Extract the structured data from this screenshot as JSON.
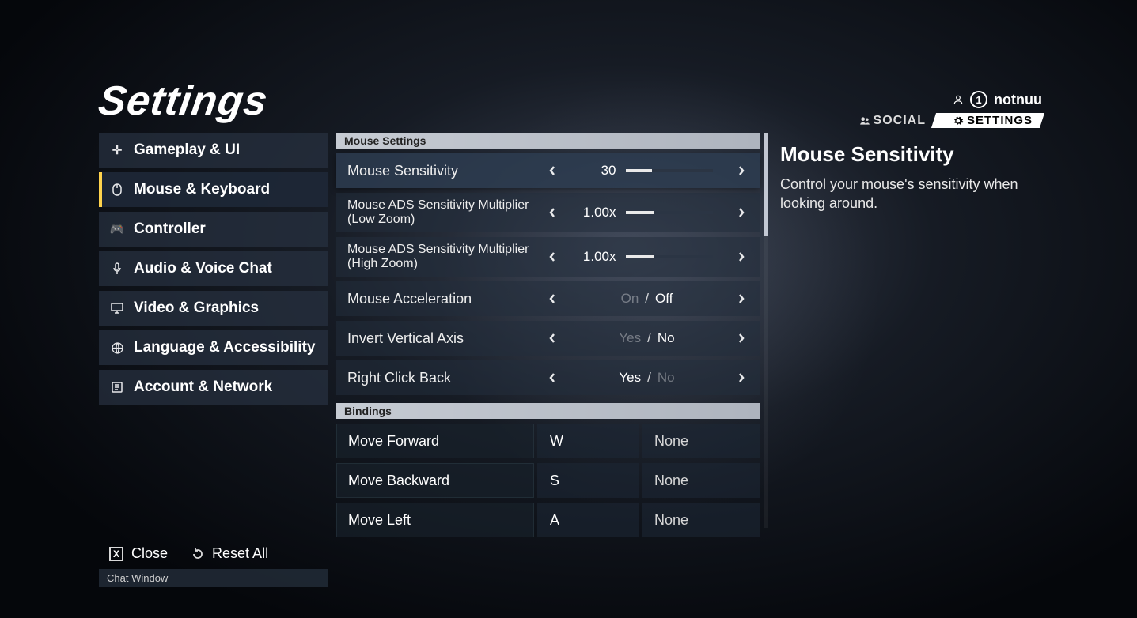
{
  "title": "Settings",
  "user": {
    "name": "notnuu",
    "level": "1"
  },
  "rt_tabs": {
    "social": "SOCIAL",
    "settings": "SETTINGS"
  },
  "sidebar": {
    "items": [
      {
        "id": "gameplay",
        "label": "Gameplay & UI",
        "icon": "crosshair-icon"
      },
      {
        "id": "mkb",
        "label": "Mouse & Keyboard",
        "icon": "mouse-icon"
      },
      {
        "id": "controller",
        "label": "Controller",
        "icon": "gamepad-icon"
      },
      {
        "id": "audio",
        "label": "Audio & Voice Chat",
        "icon": "mic-icon"
      },
      {
        "id": "video",
        "label": "Video & Graphics",
        "icon": "monitor-icon"
      },
      {
        "id": "lang",
        "label": "Language & Accessibility",
        "icon": "globe-icon"
      },
      {
        "id": "account",
        "label": "Account & Network",
        "icon": "account-icon"
      }
    ],
    "active": "mkb"
  },
  "sections": {
    "mouse_hdr": "Mouse Settings",
    "bind_hdr": "Bindings"
  },
  "rows": {
    "sens": {
      "label": "Mouse Sensitivity",
      "value": "30",
      "fill": 30
    },
    "ads_low": {
      "label": "Mouse ADS Sensitivity Multiplier (Low Zoom)",
      "value": "1.00x",
      "fill": 33
    },
    "ads_high": {
      "label": "Mouse ADS Sensitivity Multiplier (High Zoom)",
      "value": "1.00x",
      "fill": 33
    },
    "accel": {
      "label": "Mouse Acceleration",
      "on": "On",
      "off": "Off",
      "sep": "/",
      "selected": "off"
    },
    "invert": {
      "label": "Invert Vertical Axis",
      "on": "Yes",
      "off": "No",
      "sep": "/",
      "selected": "off"
    },
    "rcb": {
      "label": "Right Click Back",
      "on": "Yes",
      "off": "No",
      "sep": "/",
      "selected": "on"
    }
  },
  "bindings": [
    {
      "label": "Move Forward",
      "primary": "W",
      "secondary": "None"
    },
    {
      "label": "Move Backward",
      "primary": "S",
      "secondary": "None"
    },
    {
      "label": "Move Left",
      "primary": "A",
      "secondary": "None"
    }
  ],
  "desc": {
    "title": "Mouse Sensitivity",
    "body": "Control your mouse's sensitivity when looking around."
  },
  "footer": {
    "close": "Close",
    "close_key": "X",
    "reset": "Reset All"
  },
  "chat": "Chat Window"
}
